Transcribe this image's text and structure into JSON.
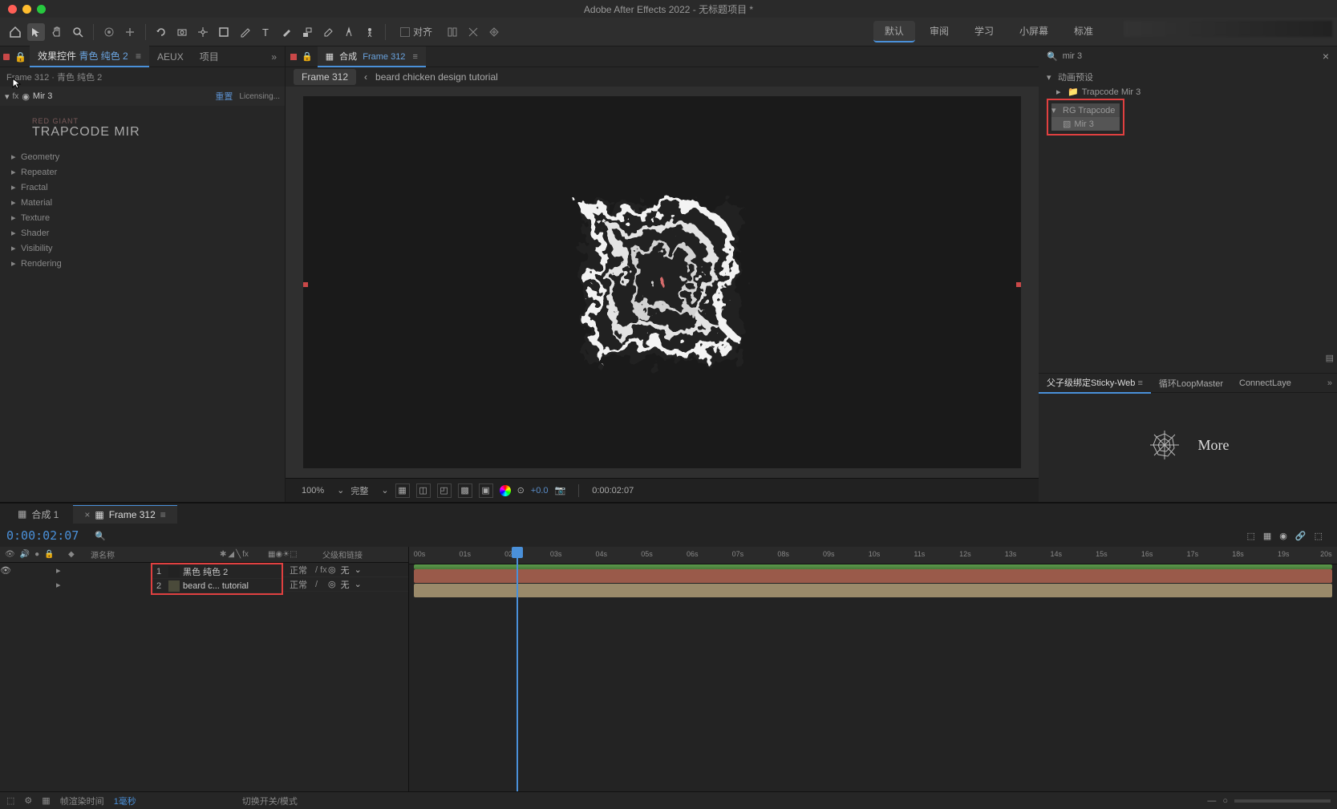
{
  "app": {
    "title": "Adobe After Effects 2022 - 无标题项目 *"
  },
  "toolbar": {
    "align_label": "对齐",
    "workspaces": [
      "默认",
      "审阅",
      "学习",
      "小屏幕",
      "标准"
    ],
    "active_workspace": 0
  },
  "left_panel": {
    "tabs": {
      "effect_controls": "效果控件",
      "layer_ref": "青色 纯色 2",
      "aeux": "AEUX",
      "project": "项目"
    },
    "header": "Frame 312 · 青色 纯色 2",
    "effect": {
      "name": "Mir 3",
      "reset": "重置",
      "licensing": "Licensing..."
    },
    "brand": {
      "vendor": "RED GIANT",
      "name": "TRAPCODE MIR"
    },
    "props": [
      "Geometry",
      "Repeater",
      "Fractal",
      "Material",
      "Texture",
      "Shader",
      "Visibility",
      "Rendering"
    ]
  },
  "comp": {
    "tab_label": "合成",
    "tab_name": "Frame 312",
    "breadcrumb": [
      "Frame 312",
      "beard chicken design tutorial"
    ],
    "zoom": "100%",
    "resolution": "完整",
    "exposure": "+0.0",
    "timecode": "0:00:02:07"
  },
  "effects_browser": {
    "search": "mir 3",
    "tree": {
      "root": "动画预设",
      "folder1": "Trapcode Mir 3",
      "folder2": "RG Trapcode",
      "item": "Mir 3"
    },
    "close": "×"
  },
  "scripts": {
    "tabs": [
      "父子级绑定Sticky-Web",
      "循环LoopMaster",
      "ConnectLaye"
    ],
    "more": "More"
  },
  "timeline": {
    "tabs": [
      {
        "label": "合成 1",
        "active": false
      },
      {
        "label": "Frame 312",
        "active": true
      }
    ],
    "timecode": "0:00:02:07",
    "columns": {
      "source": "源名称",
      "parent": "父级和链接"
    },
    "layers": [
      {
        "num": "1",
        "name": "黑色 纯色 2",
        "mode": "正常",
        "fx": "/ fx",
        "parent": "无"
      },
      {
        "num": "2",
        "name": "beard c... tutorial",
        "mode": "正常",
        "fx": "/",
        "parent": "无"
      }
    ],
    "ruler_ticks": [
      "00s",
      "01s",
      "02s",
      "03s",
      "04s",
      "05s",
      "06s",
      "07s",
      "08s",
      "09s",
      "10s",
      "11s",
      "12s",
      "13s",
      "14s",
      "15s",
      "16s",
      "17s",
      "18s",
      "19s",
      "20s"
    ],
    "footer": {
      "render_label": "帧渲染时间",
      "render_time": "1毫秒",
      "switches": "切换开关/模式"
    }
  }
}
